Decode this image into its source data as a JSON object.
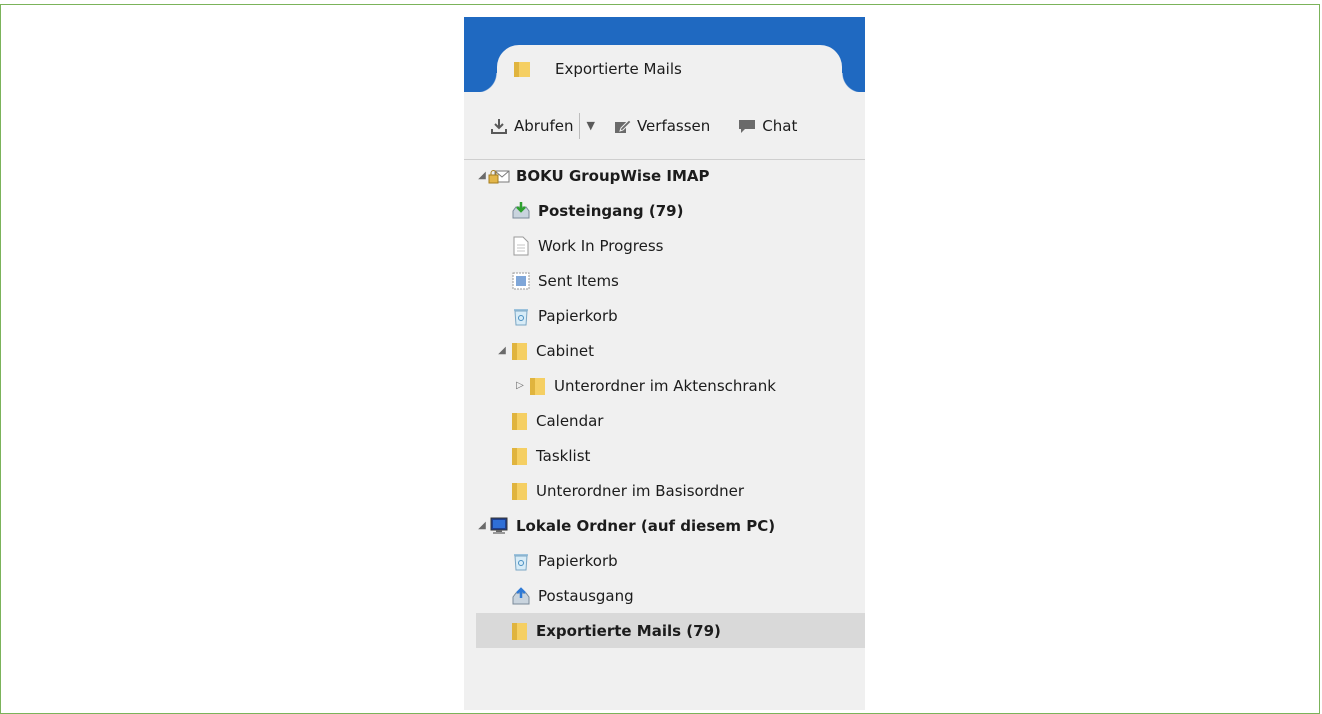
{
  "tab": {
    "title": "Exportierte Mails"
  },
  "toolbar": {
    "get_label": "Abrufen",
    "compose_label": "Verfassen",
    "chat_label": "Chat"
  },
  "tree": {
    "account1": {
      "label": "BOKU GroupWise IMAP"
    },
    "inbox": {
      "label": "Posteingang (79)"
    },
    "wip": {
      "label": "Work In Progress"
    },
    "sent": {
      "label": "Sent Items"
    },
    "trash1": {
      "label": "Papierkorb"
    },
    "cabinet": {
      "label": "Cabinet"
    },
    "cabinet_sub": {
      "label": "Unterordner im Aktenschrank"
    },
    "calendar": {
      "label": "Calendar"
    },
    "tasklist": {
      "label": "Tasklist"
    },
    "base_sub": {
      "label": "Unterordner im Basisordner"
    },
    "local": {
      "label": "Lokale Ordner (auf diesem PC)"
    },
    "trash2": {
      "label": "Papierkorb"
    },
    "outbox": {
      "label": "Postausgang"
    },
    "exported": {
      "label": "Exportierte Mails (79)"
    }
  },
  "colors": {
    "titlebar": "#1f69c1",
    "folder": "#f5cf63",
    "frame_border": "#7bb35a"
  }
}
